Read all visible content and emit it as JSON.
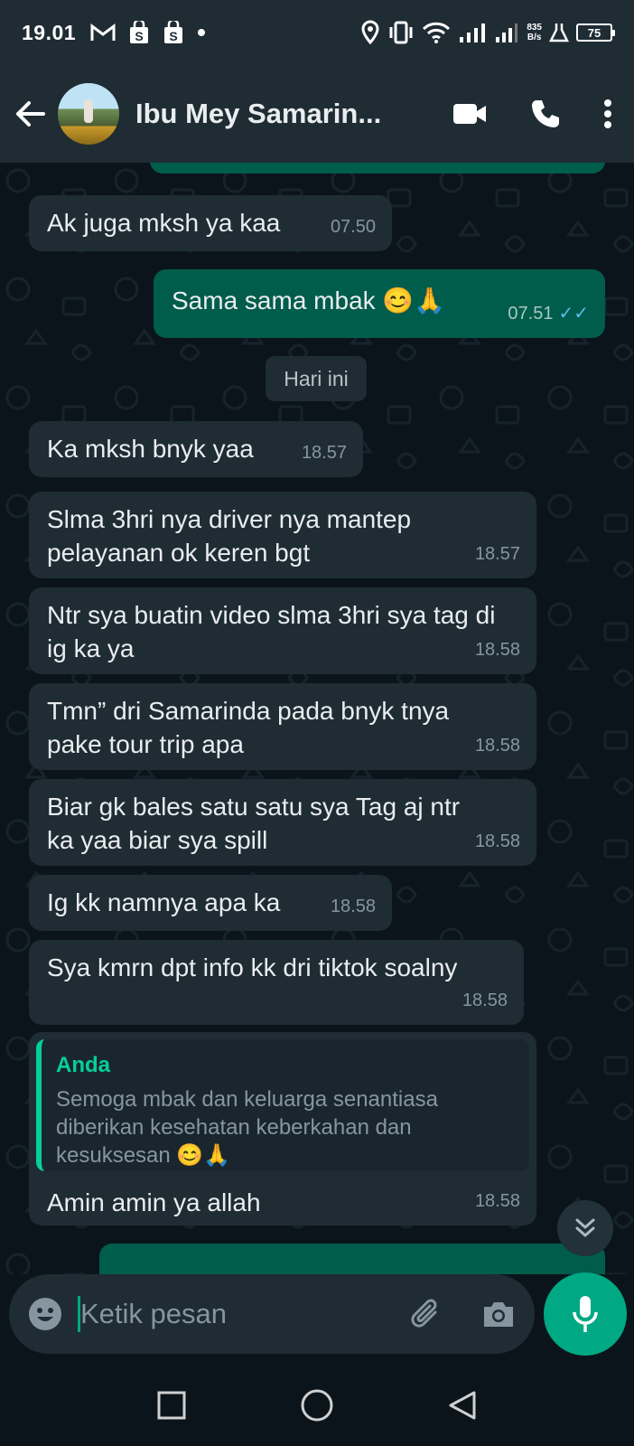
{
  "status_bar": {
    "time": "19.01",
    "net_speed_value": "835",
    "net_speed_unit": "B/s",
    "battery": "75"
  },
  "header": {
    "contact_name": "Ibu Mey Samarin..."
  },
  "chat": {
    "date_chip": "Hari ini",
    "messages": [
      {
        "text": "Ak juga mksh ya kaa",
        "time": "07.50"
      },
      {
        "text": "Sama sama mbak 😊🙏",
        "time": "07.51"
      },
      {
        "text": "Ka mksh bnyk yaa",
        "time": "18.57"
      },
      {
        "text": "Slma 3hri nya driver nya mantep pelayanan ok keren bgt",
        "time": "18.57"
      },
      {
        "text": "Ntr sya buatin video slma 3hri sya tag di ig ka ya",
        "time": "18.58"
      },
      {
        "text": "Tmn” dri Samarinda pada bnyk tnya pake tour trip apa",
        "time": "18.58"
      },
      {
        "text": "Biar gk bales satu satu sya Tag aj ntr ka yaa biar sya spill",
        "time": "18.58"
      },
      {
        "text": "Ig kk namnya apa ka",
        "time": "18.58"
      },
      {
        "text": "Sya kmrn dpt info kk dri tiktok soalny",
        "time": "18.58"
      },
      {
        "text": "Amin amin ya allah",
        "time": "18.58",
        "quote_author": "Anda",
        "quote_text": "Semoga mbak dan keluarga senantiasa diberikan kesehatan keberkahan dan kesuksesan 😊🙏"
      }
    ]
  },
  "input": {
    "placeholder": "Ketik pesan"
  },
  "colors": {
    "incoming": "#1f2c34",
    "outgoing": "#005c4b",
    "accent": "#00a884",
    "read_ticks": "#53bdeb"
  },
  "icons": [
    "gmail-icon",
    "shop-icon",
    "location-icon",
    "vibrate-icon",
    "wifi-icon",
    "signal-icon",
    "battery-icon",
    "back-arrow-icon",
    "video-call-icon",
    "phone-icon",
    "more-vert-icon",
    "emoji-icon",
    "attach-icon",
    "camera-icon",
    "mic-icon",
    "chevron-double-down-icon",
    "recents-icon",
    "home-icon",
    "back-icon"
  ]
}
